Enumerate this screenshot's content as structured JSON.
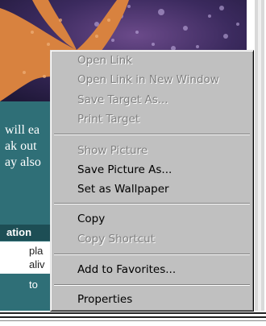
{
  "page": {
    "body_lines": [
      "will ea",
      "ak out",
      "ay also"
    ],
    "table_header": "ation",
    "table_row1": [
      "pla",
      "aliv"
    ],
    "table_row2": "to"
  },
  "context_menu": {
    "items": [
      {
        "label": "Open Link",
        "enabled": false
      },
      {
        "label": "Open Link in New Window",
        "enabled": false
      },
      {
        "label": "Save Target As...",
        "enabled": false
      },
      {
        "label": "Print Target",
        "enabled": false
      },
      {
        "label": "Show Picture",
        "enabled": false
      },
      {
        "label": "Save Picture As...",
        "enabled": true
      },
      {
        "label": "Set as Wallpaper",
        "enabled": true
      },
      {
        "label": "Copy",
        "enabled": true
      },
      {
        "label": "Copy Shortcut",
        "enabled": false
      },
      {
        "label": "Add to Favorites...",
        "enabled": true
      },
      {
        "label": "Properties",
        "enabled": true
      }
    ]
  },
  "colors": {
    "menu_bg": "#c0c0c0",
    "disabled_text": "#808080",
    "page_teal": "#2f6f77",
    "table_header": "#1d4e55"
  }
}
